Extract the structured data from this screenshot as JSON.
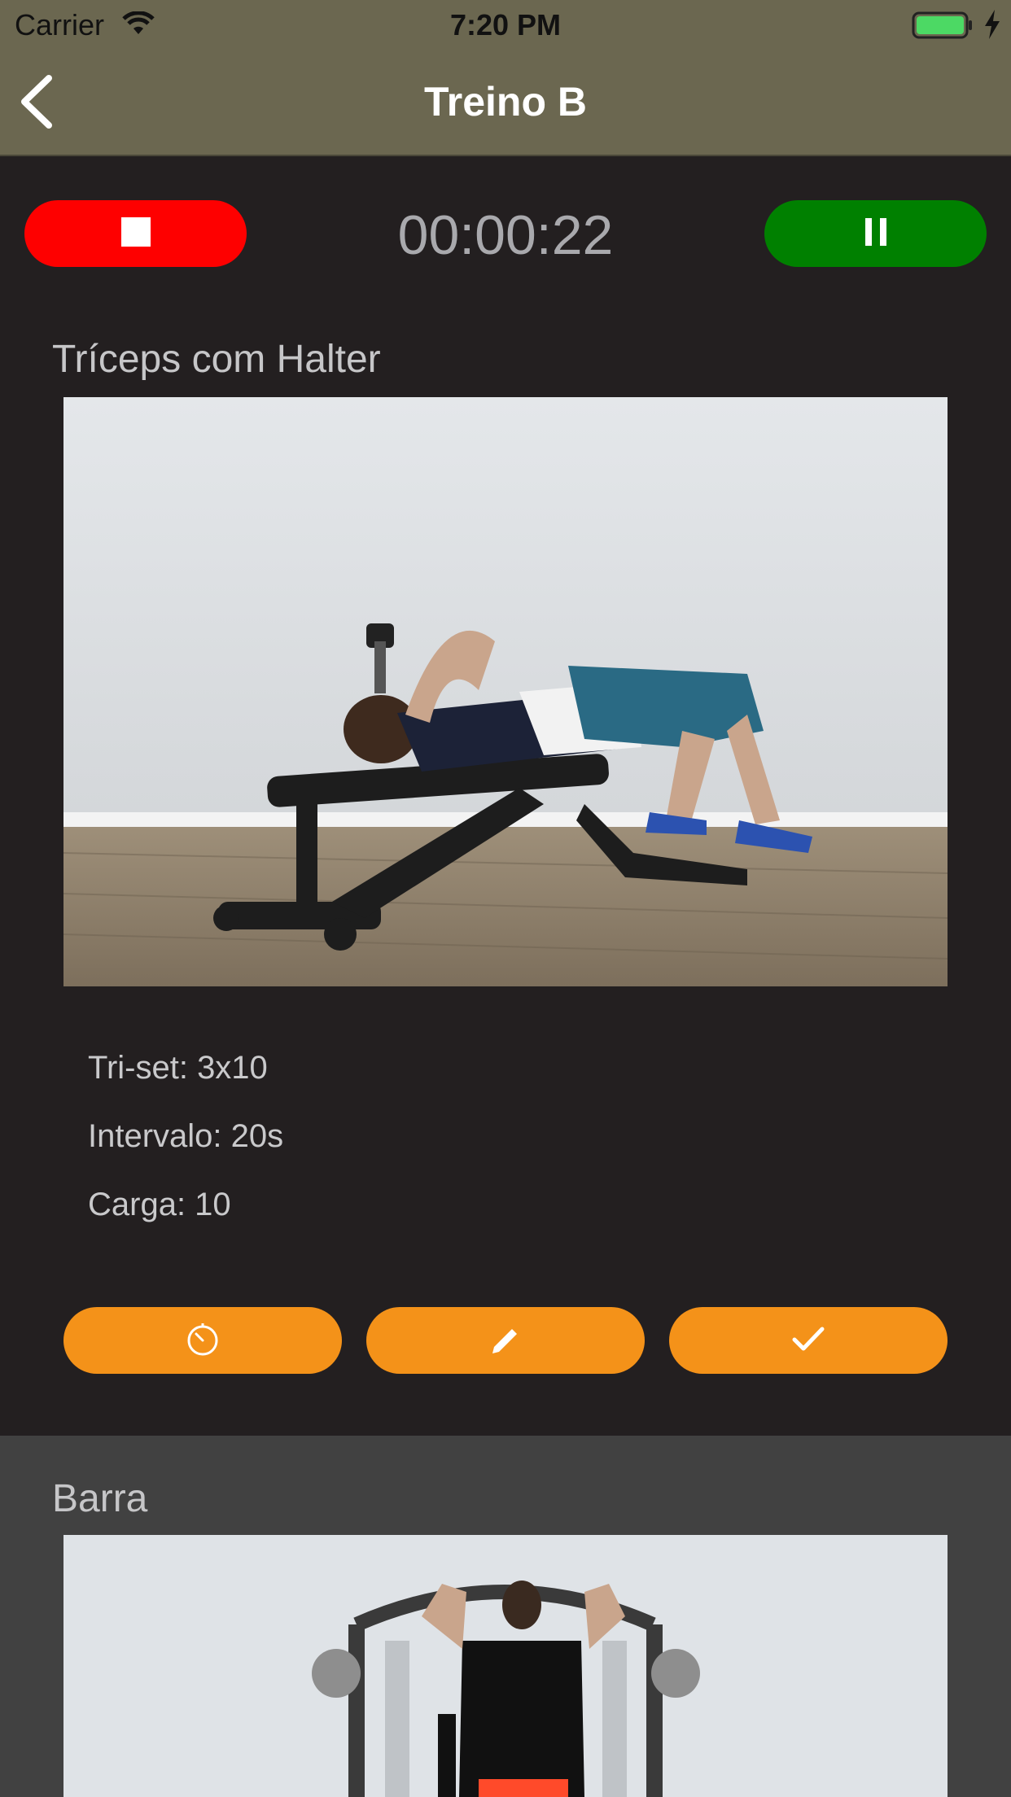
{
  "status_bar": {
    "carrier": "Carrier",
    "time": "7:20 PM"
  },
  "nav": {
    "title": "Treino B"
  },
  "controls": {
    "timer": "00:00:22"
  },
  "exercises": [
    {
      "name": "Tríceps com Halter",
      "details": [
        "Tri-set: 3x10",
        "Intervalo: 20s",
        "Carga: 10"
      ],
      "actions": [
        "timer-icon",
        "pencil-icon",
        "checkmark-icon"
      ]
    },
    {
      "name": "Barra"
    }
  ],
  "colors": {
    "bar": "#6b6750",
    "background": "#231f20",
    "card_alt": "#414141",
    "stop": "#fe0000",
    "pause": "#008000",
    "action": "#f49219"
  }
}
